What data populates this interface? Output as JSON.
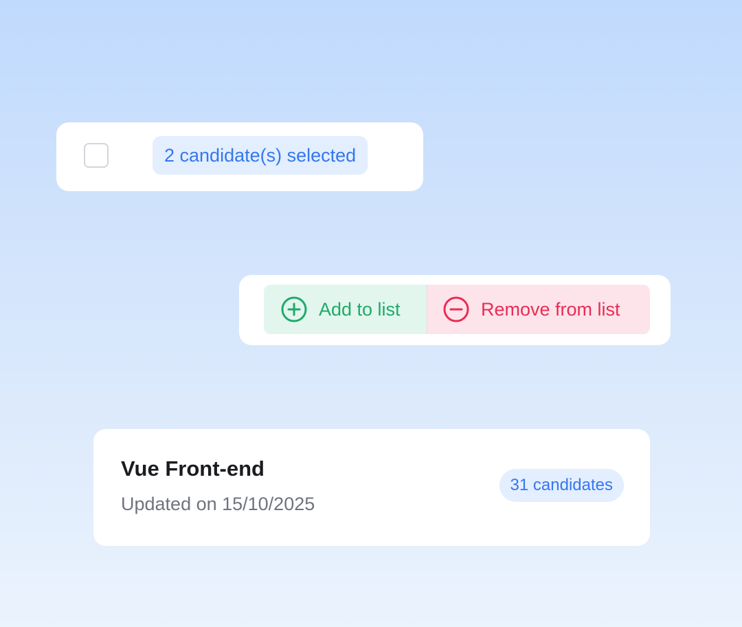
{
  "selection_bar": {
    "checkbox_checked": false,
    "selected_label": "2 candidate(s) selected"
  },
  "actions": {
    "add": {
      "label": "Add to list",
      "icon": "plus-circle-icon",
      "color": "#1faa68",
      "background": "#e2f6ee"
    },
    "remove": {
      "label": "Remove from list",
      "icon": "minus-circle-icon",
      "color": "#ea2b55",
      "background": "#fde4ea"
    }
  },
  "list_card": {
    "title": "Vue Front-end",
    "updated": "Updated on 15/10/2025",
    "count_badge": "31 candidates"
  },
  "colors": {
    "accent_blue": "#3577ee",
    "badge_blue_bg": "#e3eefe",
    "background_top": "#c0dafd",
    "background_bottom": "#ebf3fd"
  }
}
